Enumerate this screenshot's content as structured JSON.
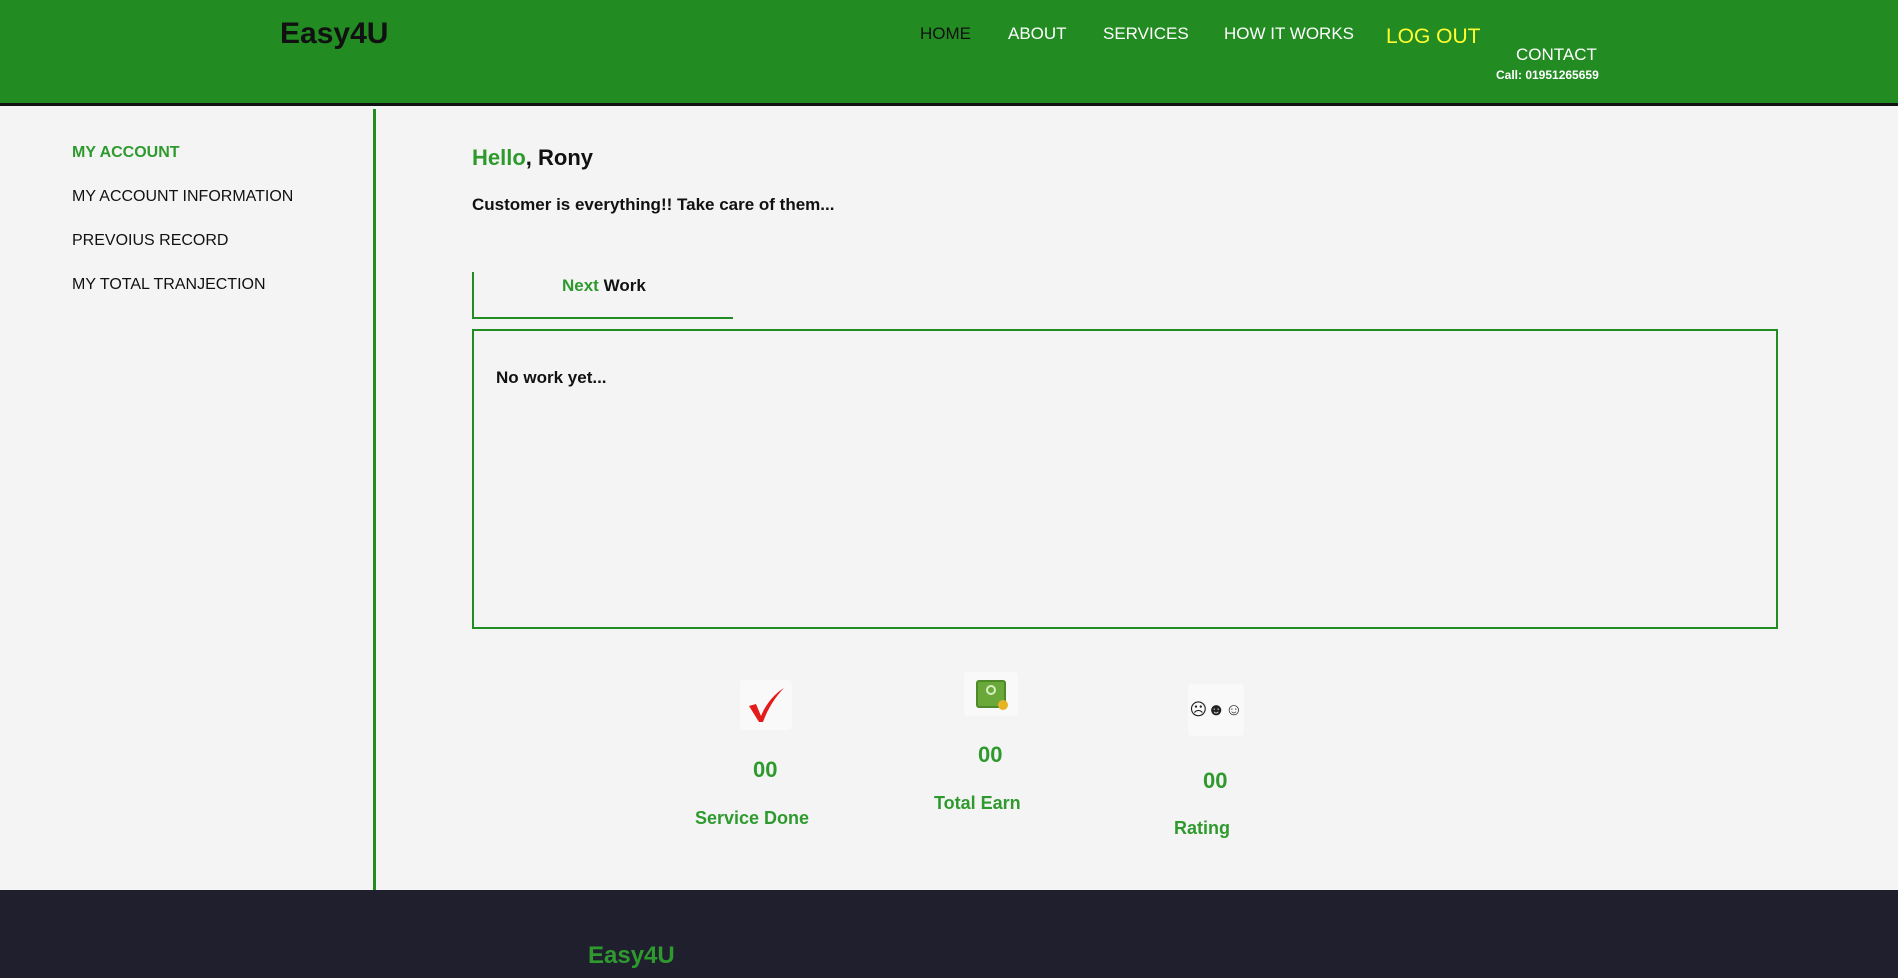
{
  "header": {
    "logo": "Easy4U",
    "nav": {
      "home": "HOME",
      "about": "ABOUT",
      "services": "SERVICES",
      "how_it_works": "HOW IT WORKS",
      "logout": "LOG OUT",
      "contact": "CONTACT",
      "call": "Call: 01951265659"
    }
  },
  "sidebar": {
    "items": [
      "MY ACCOUNT",
      "MY ACCOUNT INFORMATION",
      "PREVOIUS RECORD",
      "MY TOTAL TRANJECTION"
    ]
  },
  "main": {
    "greeting_hl": "Hello",
    "greeting_rest": ", Rony",
    "tagline": "Customer is everything!! Take care of them...",
    "tab_hl": "Next",
    "tab_rest": " Work",
    "empty_text": "No work yet..."
  },
  "stats": {
    "service_done": {
      "value": "00",
      "label": "Service Done",
      "icon": "check-icon"
    },
    "total_earn": {
      "value": "00",
      "label": "Total Earn",
      "icon": "cash-icon"
    },
    "rating": {
      "value": "00",
      "label": "Rating",
      "icon": "rating-faces-icon",
      "faces": "☹☻☺"
    }
  },
  "footer": {
    "logo": "Easy4U"
  },
  "colors": {
    "brand_green": "#228b22",
    "accent_green": "#2e9a2e",
    "logout_yellow": "#ffff33",
    "footer_bg": "#1f1f2e"
  }
}
